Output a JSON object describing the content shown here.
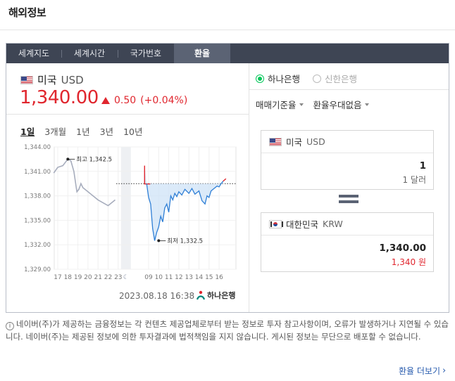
{
  "page": {
    "title": "해외정보"
  },
  "tabs": [
    {
      "label": "세계지도",
      "active": false
    },
    {
      "label": "세계시간",
      "active": false
    },
    {
      "label": "국가번호",
      "active": false
    },
    {
      "label": "환율",
      "active": true
    }
  ],
  "currency": {
    "country": "미국",
    "code": "USD",
    "rate": "1,340.00",
    "change": "0.50",
    "change_pct": "(+0.04%)",
    "direction": "up"
  },
  "periods": [
    "1일",
    "3개월",
    "1년",
    "3년",
    "10년"
  ],
  "selected_period": "1일",
  "chart_data": {
    "type": "line",
    "ylim": [
      1329,
      1344
    ],
    "y_ticks": [
      "1,344.00",
      "1,341.00",
      "1,338.00",
      "1,335.00",
      "1,332.00",
      "1,329.00"
    ],
    "y_tick_values": [
      1344,
      1341,
      1338,
      1335,
      1332,
      1329
    ],
    "x_ticks": [
      "17",
      "18",
      "19",
      "20",
      "21",
      "22",
      "23",
      "09",
      "10",
      "11",
      "12",
      "13",
      "14",
      "15",
      "16"
    ],
    "baseline": 1339.5,
    "annotations": [
      {
        "label": "최고 1,342.5",
        "x": "18",
        "y": 1342.5
      },
      {
        "label": "최저 1,332.5",
        "x": "10",
        "y": 1332.5
      }
    ],
    "prev_series": {
      "x": [
        16.6,
        17,
        17.5,
        18,
        18.3,
        18.6,
        18.9,
        19.1,
        19.3,
        19.5,
        20,
        21,
        22,
        22.7
      ],
      "y": [
        1340.8,
        1341.5,
        1341.7,
        1342.5,
        1342.3,
        1341.0,
        1338.5,
        1338.8,
        1339.5,
        1339.0,
        1338.5,
        1337.5,
        1336.8,
        1337.5
      ]
    },
    "today_series": {
      "x": [
        8.6,
        8.8,
        9.0,
        9.2,
        9.4,
        9.6,
        9.8,
        10.0,
        10.2,
        10.4,
        10.6,
        10.8,
        11.0,
        11.2,
        11.4,
        11.6,
        11.8,
        12.0,
        12.3,
        12.6,
        13.0,
        13.3,
        13.6,
        14.0,
        14.3,
        14.6,
        14.8,
        15.0,
        15.2,
        15.5,
        15.8,
        16.0,
        16.2,
        16.4
      ],
      "y": [
        1341.7,
        1339.5,
        1337.8,
        1337.0,
        1334.0,
        1332.5,
        1333.5,
        1334.2,
        1335.5,
        1334.8,
        1336.5,
        1337.0,
        1336.0,
        1338.0,
        1337.5,
        1338.3,
        1337.9,
        1338.5,
        1338.1,
        1338.8,
        1338.3,
        1338.9,
        1338.2,
        1338.6,
        1337.4,
        1337.0,
        1338.0,
        1337.8,
        1338.6,
        1338.9,
        1339.2,
        1339.1,
        1339.5,
        1339.8
      ]
    }
  },
  "updated_at": "2023.08.18 16:38",
  "bank_logo_text": "하나은행",
  "banks": [
    {
      "label": "하나은행",
      "selected": true
    },
    {
      "label": "신한은행",
      "selected": false
    }
  ],
  "dropdowns": {
    "rate_type": "매매기준율",
    "preference": "환율우대없음"
  },
  "converter": {
    "from": {
      "country": "미국",
      "code": "USD",
      "value": "1",
      "sub": "1 달러"
    },
    "to": {
      "country": "대한민국",
      "code": "KRW",
      "value": "1,340.00",
      "sub": "1,340 원"
    }
  },
  "notice": "네이버(주)가 제공하는 금융정보는 각 컨텐츠 제공업체로부터 받는 정보로 투자 참고사항이며, 오류가 발생하거나 지연될 수 있습니다. 네이버(주)는 제공된 정보에 의한 투자결과에 법적책임을 지지 않습니다. 게시된 정보는 무단으로 배포할 수 없습니다.",
  "more_link": "환율 더보기",
  "colors": {
    "accent_red": "#e0262e",
    "radio_green": "#03c75a",
    "tab_bg": "#3e4554",
    "link_blue": "#2a5daf"
  }
}
